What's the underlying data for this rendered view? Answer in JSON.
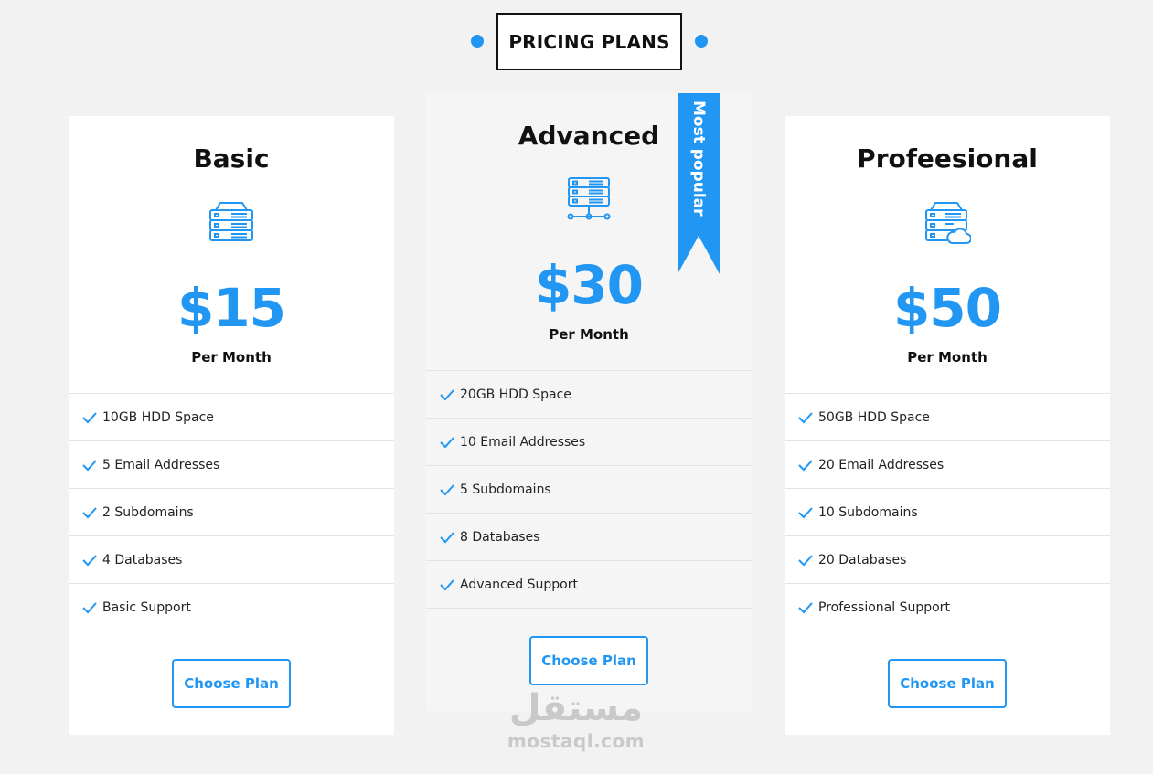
{
  "colors": {
    "accent": "#2196f3",
    "background": "#f2f2f2",
    "card": "#ffffff",
    "featured_card": "#f5f5f5"
  },
  "header": {
    "title": "PRICING PLANS"
  },
  "ribbon": {
    "label": "Most popular"
  },
  "plans": [
    {
      "name": "Basic",
      "icon": "server-stack-icon",
      "price": "$15",
      "period": "Per Month",
      "features": [
        "10GB HDD Space",
        "5 Email Addresses",
        "2 Subdomains",
        "4 Databases",
        "Basic Support"
      ],
      "button": "Choose Plan"
    },
    {
      "name": "Advanced",
      "icon": "server-network-icon",
      "price": "$30",
      "period": "Per Month",
      "features": [
        "20GB HDD Space",
        "10 Email Addresses",
        "5 Subdomains",
        "8 Databases",
        "Advanced Support"
      ],
      "button": "Choose Plan"
    },
    {
      "name": "Profeesional",
      "icon": "server-cloud-icon",
      "price": "$50",
      "period": "Per Month",
      "features": [
        "50GB HDD Space",
        "20 Email Addresses",
        "10 Subdomains",
        "20 Databases",
        "Professional Support"
      ],
      "button": "Choose Plan"
    }
  ],
  "watermark": {
    "arabic": "مستقل",
    "latin": "mostaql.com"
  }
}
